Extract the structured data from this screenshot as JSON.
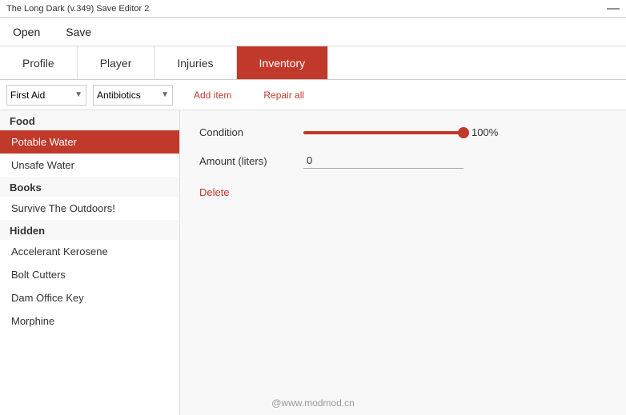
{
  "titleBar": {
    "title": "The Long Dark (v.349) Save Editor 2",
    "closeLabel": "—"
  },
  "menuBar": {
    "items": [
      "Open",
      "Save"
    ]
  },
  "tabs": [
    {
      "id": "profile",
      "label": "Profile",
      "active": false
    },
    {
      "id": "player",
      "label": "Player",
      "active": false
    },
    {
      "id": "injuries",
      "label": "Injuries",
      "active": false
    },
    {
      "id": "inventory",
      "label": "Inventory",
      "active": true
    }
  ],
  "toolbar": {
    "categoryLabel": "First Aid",
    "subcategoryLabel": "Antibiotics",
    "addItemLabel": "Add item",
    "repairAllLabel": "Repair all"
  },
  "listPanel": {
    "groups": [
      {
        "header": "Food",
        "items": [
          {
            "label": "Potable Water",
            "selected": true
          },
          {
            "label": "Unsafe Water",
            "selected": false
          }
        ]
      },
      {
        "header": "Books",
        "items": [
          {
            "label": "Survive The Outdoors!",
            "selected": false
          }
        ]
      },
      {
        "header": "Hidden",
        "items": [
          {
            "label": "Accelerant Kerosene",
            "selected": false
          },
          {
            "label": "Bolt Cutters",
            "selected": false
          },
          {
            "label": "Dam Office Key",
            "selected": false
          },
          {
            "label": "Morphine",
            "selected": false
          }
        ]
      }
    ]
  },
  "detailPanel": {
    "conditionLabel": "Condition",
    "conditionValue": "100%",
    "conditionPercent": 100,
    "amountLabel": "Amount (liters)",
    "amountValue": "0",
    "deleteLabel": "Delete"
  },
  "footer": {
    "watermark": "@www.modmod.cn"
  }
}
